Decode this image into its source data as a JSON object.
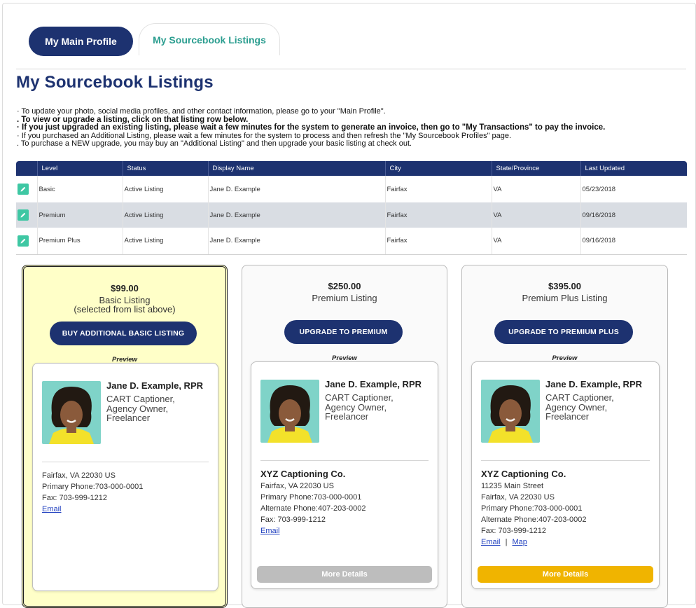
{
  "tabs": {
    "main_profile": "My Main Profile",
    "sourcebook": "My Sourcebook Listings"
  },
  "page_title": "My Sourcebook Listings",
  "instructions": [
    "· To update your photo, social media profiles, and other contact information, please go to your \"Main Profile\".",
    ". To view or upgrade a listing, click on that listing row below.",
    "· If you just upgraded an existing listing, please wait a few minutes for the system to generate an invoice, then go to \"My Transactions\" to pay the invoice.",
    "· If you purchased an Additional Listing, please wait a few minutes for the system to process and then refresh the \"My Sourcebook Profiles\" page.",
    ". To purchase a NEW upgrade, you may buy an \"Additional Listing\" and then upgrade your basic listing at check out."
  ],
  "table": {
    "headers": [
      "Level",
      "Status",
      "Display Name",
      "City",
      "State/Province",
      "Last Updated"
    ],
    "rows": [
      {
        "level": "Basic",
        "status": "Active Listing",
        "name": "Jane D. Example",
        "city": "Fairfax",
        "state": "VA",
        "updated": "05/23/2018"
      },
      {
        "level": "Premium",
        "status": "Active Listing",
        "name": "Jane D. Example",
        "city": "Fairfax",
        "state": "VA",
        "updated": "09/16/2018"
      },
      {
        "level": "Premium Plus",
        "status": "Active Listing",
        "name": "Jane D. Example",
        "city": "Fairfax",
        "state": "VA",
        "updated": "09/16/2018"
      }
    ]
  },
  "cards": {
    "basic": {
      "price": "$99.00",
      "level": "Basic Listing",
      "note": "(selected from list above)",
      "button": "BUY ADDITIONAL BASIC LISTING",
      "preview_label": "Preview",
      "name": "Jane D. Example, RPR",
      "roles": [
        "CART Captioner,",
        "Agency Owner,",
        "Freelancer"
      ],
      "address": "Fairfax, VA 22030 US",
      "primary_phone": "Primary Phone:703-000-0001",
      "fax": "Fax: 703-999-1212",
      "email": "Email"
    },
    "premium": {
      "price": "$250.00",
      "level": "Premium Listing",
      "button": "UPGRADE TO PREMIUM",
      "preview_label": "Preview",
      "name": "Jane D. Example, RPR",
      "roles": [
        "CART Captioner,",
        "Agency Owner,",
        "Freelancer"
      ],
      "company": "XYZ Captioning Co.",
      "address": "Fairfax, VA 22030 US",
      "primary_phone": "Primary Phone:703-000-0001",
      "alt_phone": "Alternate Phone:407-203-0002",
      "fax": "Fax: 703-999-1212",
      "email": "Email",
      "more": "More Details"
    },
    "premium_plus": {
      "price": "$395.00",
      "level": "Premium Plus Listing",
      "button": "UPGRADE TO PREMIUM PLUS",
      "preview_label": "Preview",
      "name": "Jane D. Example, RPR",
      "roles": [
        "CART Captioner,",
        "Agency Owner,",
        "Freelancer"
      ],
      "company": "XYZ Captioning Co.",
      "street": "11235 Main Street",
      "address": "Fairfax, VA 22030 US",
      "primary_phone": "Primary Phone:703-000-0001",
      "alt_phone": "Alternate Phone:407-203-0002",
      "fax": "Fax: 703-999-1212",
      "email": "Email",
      "separator": "|",
      "map": "Map",
      "more": "More Details"
    }
  },
  "colors": {
    "navy": "#1d3270",
    "teal": "#2a9d8f",
    "edit_green": "#3ec7a3",
    "selected_card": "#ffffc8",
    "more_disabled": "#bdbdbd",
    "more_active": "#f0b400"
  }
}
